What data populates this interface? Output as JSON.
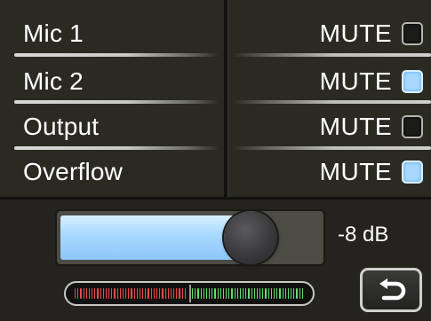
{
  "channels": [
    {
      "name": "Mic 1",
      "mute_label": "MUTE",
      "muted": false
    },
    {
      "name": "Mic 2",
      "mute_label": "MUTE",
      "muted": true
    },
    {
      "name": "Output",
      "mute_label": "MUTE",
      "muted": false
    },
    {
      "name": "Overflow",
      "mute_label": "MUTE",
      "muted": true
    }
  ],
  "level": {
    "readout": "-8 dB",
    "slider_fraction": 0.78
  },
  "meter": {
    "left_segments": 40,
    "right_segments": 40,
    "left_color": "#e84a4a",
    "right_color": "#5ee06a"
  },
  "colors": {
    "background": "#2b2a22",
    "accent_on": "#a8d8ff",
    "text": "#ffffff"
  },
  "icons": {
    "back": "back-arrow-icon"
  }
}
